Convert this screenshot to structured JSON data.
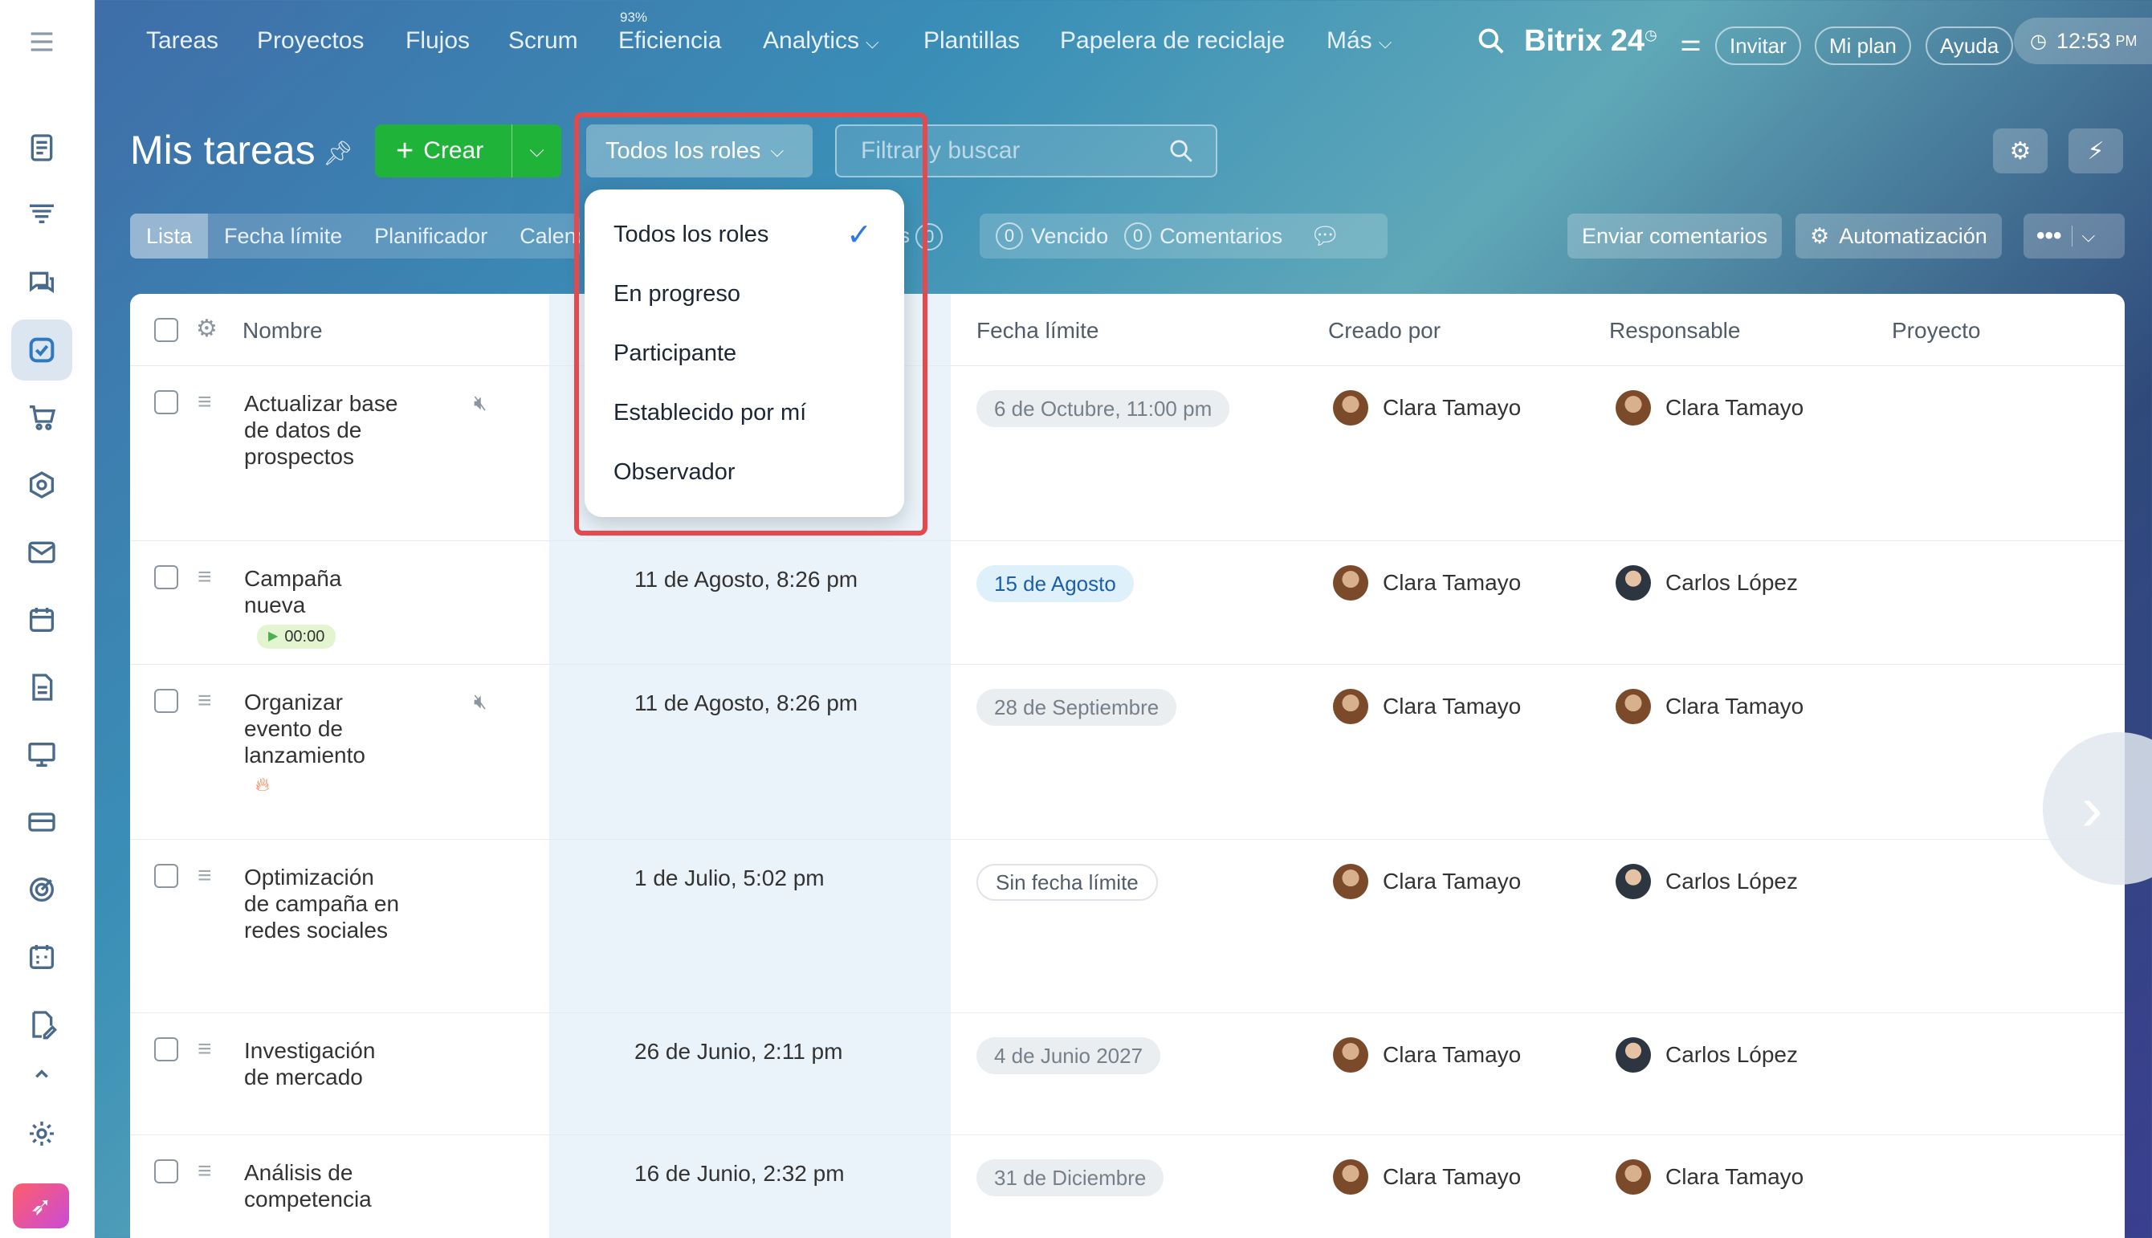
{
  "topnav": {
    "items": [
      "Tareas",
      "Proyectos",
      "Flujos",
      "Scrum",
      "Eficiencia",
      "Analytics",
      "Plantillas",
      "Papelera de reciclaje",
      "Más"
    ],
    "efficiency_badge": "93%",
    "brand": "Bitrix 24",
    "invite": "Invitar",
    "plan": "Mi plan",
    "help": "Ayuda",
    "time": "12:53",
    "time_suffix": "PM"
  },
  "toolbar": {
    "title": "Mis tareas",
    "create_label": "Crear",
    "roles_label": "Todos los roles",
    "search_placeholder": "Filtrar y buscar"
  },
  "view_tabs": [
    "Lista",
    "Fecha límite",
    "Planificador",
    "Calendario"
  ],
  "counters": {
    "overdue_count": "0",
    "overdue_label": "Vencido",
    "comments_count": "0",
    "comments_label": "Comentarios",
    "hidden_count": "0"
  },
  "actions": {
    "feedback": "Enviar comentarios",
    "automation": "Automatización"
  },
  "table": {
    "headers": {
      "name": "Nombre",
      "deadline": "Fecha límite",
      "created_by": "Creado por",
      "responsible": "Responsable",
      "project": "Proyecto"
    },
    "rows": [
      {
        "name": "Actualizar base de datos de prospectos",
        "created": "",
        "deadline": "6 de Octubre, 11:00 pm",
        "created_by": "Clara Tamayo",
        "responsible": "Clara Tamayo"
      },
      {
        "name": "Campaña nueva",
        "timer": "00:00",
        "created": "11 de Agosto, 8:26 pm",
        "deadline": "15 de Agosto",
        "created_by": "Clara Tamayo",
        "responsible": "Carlos López"
      },
      {
        "name": "Organizar evento de lanzamiento",
        "created": "11 de Agosto, 8:26 pm",
        "deadline": "28 de Septiembre",
        "created_by": "Clara Tamayo",
        "responsible": "Clara Tamayo"
      },
      {
        "name": "Optimización de campaña en redes sociales",
        "created": "1 de Julio, 5:02 pm",
        "deadline": "Sin fecha límite",
        "created_by": "Clara Tamayo",
        "responsible": "Carlos López"
      },
      {
        "name": "Investigación de mercado",
        "created": "26 de Junio, 2:11 pm",
        "deadline": "4 de Junio 2027",
        "created_by": "Clara Tamayo",
        "responsible": "Carlos López"
      },
      {
        "name": "Análisis de competencia",
        "created": "16 de Junio, 2:32 pm",
        "deadline": "31 de Diciembre",
        "created_by": "Clara Tamayo",
        "responsible": "Clara Tamayo"
      }
    ]
  },
  "roles_dropdown": {
    "options": [
      "Todos los roles",
      "En progreso",
      "Participante",
      "Establecido por mí",
      "Observador"
    ],
    "selected": "Todos los roles"
  },
  "colors": {
    "create_green": "#1fb33a",
    "highlight_red": "#e5484d",
    "check_blue": "#2f79e0"
  }
}
